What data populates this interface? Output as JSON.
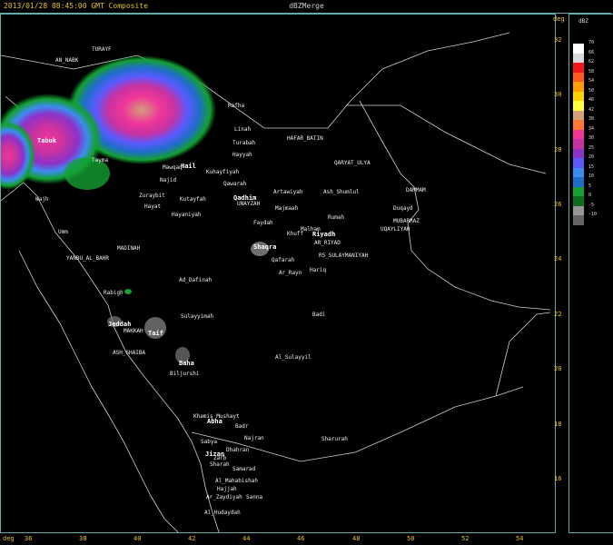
{
  "header": {
    "timestamp": "2013/01/28 08:45:00 GMT Composite",
    "product": "dBZMerge"
  },
  "axes": {
    "lat_unit": "deg",
    "lon_unit": "deg",
    "lat_ticks": [
      "32",
      "30",
      "28",
      "26",
      "24",
      "22",
      "20",
      "18",
      "16"
    ],
    "lon_ticks": [
      "36",
      "38",
      "40",
      "42",
      "44",
      "46",
      "48",
      "50",
      "52",
      "54"
    ]
  },
  "legend": {
    "title": "dBZ",
    "levels": [
      {
        "value": "70",
        "color": "#ffffff"
      },
      {
        "value": "66",
        "color": "#d9d9d9"
      },
      {
        "value": "62",
        "color": "#f01818"
      },
      {
        "value": "58",
        "color": "#ff5a1e"
      },
      {
        "value": "54",
        "color": "#ff9c00"
      },
      {
        "value": "50",
        "color": "#ffd200"
      },
      {
        "value": "46",
        "color": "#ffff3c"
      },
      {
        "value": "42",
        "color": "#d2a078"
      },
      {
        "value": "38",
        "color": "#ff7832"
      },
      {
        "value": "34",
        "color": "#f0369a"
      },
      {
        "value": "30",
        "color": "#c832a0"
      },
      {
        "value": "25",
        "color": "#8c32c8"
      },
      {
        "value": "20",
        "color": "#5a5aff"
      },
      {
        "value": "15",
        "color": "#3c8cf0"
      },
      {
        "value": "10",
        "color": "#1e6ec8"
      },
      {
        "value": "5",
        "color": "#14a032"
      },
      {
        "value": "0",
        "color": "#0a6e1e"
      },
      {
        "value": "-5",
        "color": "#969696"
      },
      {
        "value": "-10",
        "color": "#646464"
      }
    ]
  },
  "places": [
    "TURAYF",
    "AN_NABK",
    "Rafha",
    "Linah",
    "HAFAR_BATIN",
    "QARYAT_ULYA",
    "Turabah",
    "Hayyah",
    "Tabuk",
    "Tayma",
    "Mawqaq",
    "Hail",
    "Kuhayfiyah",
    "Qawarah",
    "Artawiyah",
    "Ash_Shumlul",
    "Najid",
    "Zuraybit",
    "Kutayfah",
    "Qadhim",
    "UNAYZAH",
    "Majmaah",
    "Rumah",
    "DAMMAM",
    "Duqayd",
    "MUBARRAZ",
    "Hayat",
    "Hayaniyah",
    "Faydah",
    "Malham",
    "UQAYLIYAH",
    "Wajh",
    "Riyadh",
    "Khuff",
    "AR_RIYAD",
    "Umm",
    "Shaqra",
    "MADINAH",
    "RS_SULAYMANIYAH",
    "YANBU_AL_BAHR",
    "Qafarah",
    "Hariq",
    "Ar_Rayn",
    "Ad_Dafinah",
    "Rabigh",
    "Sulayyimah",
    "Badi",
    "Jeddah",
    "MAKKAH",
    "Taif",
    "ASH_SHAIBA",
    "Al_Sulayyil",
    "Baha",
    "Biljurshi",
    "Khamis_Mushayt",
    "Abha",
    "Badr",
    "Najran",
    "Sharurah",
    "Sabya",
    "Jizan",
    "Dhahran",
    "Zarb",
    "Sharah",
    "Samarad",
    "Al_Mahabishah",
    "Hajjah",
    "Ar_Zaydiyah",
    "Sanna",
    "Al_Hudaydah"
  ]
}
